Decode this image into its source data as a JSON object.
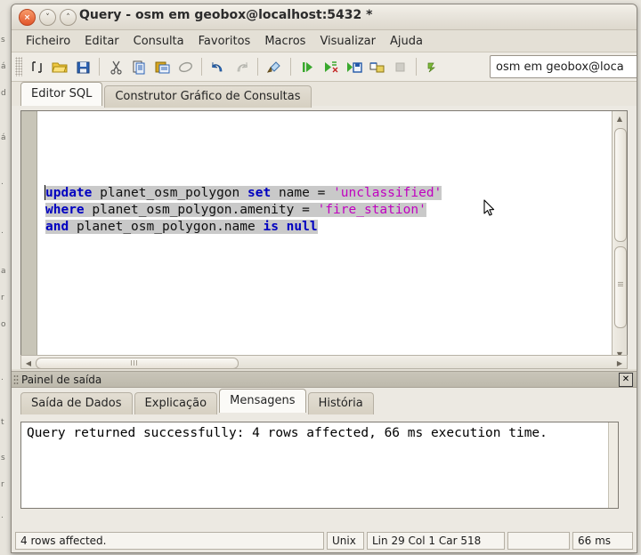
{
  "window": {
    "title": "Query - osm em geobox@localhost:5432 *",
    "buttons": {
      "close": "×",
      "minimize": "˅",
      "maximize": "˄"
    }
  },
  "menubar": {
    "items": [
      {
        "label": "Ficheiro"
      },
      {
        "label": "Editar"
      },
      {
        "label": "Consulta"
      },
      {
        "label": "Favoritos"
      },
      {
        "label": "Macros"
      },
      {
        "label": "Visualizar"
      },
      {
        "label": "Ajuda"
      }
    ]
  },
  "toolbar": {
    "icons": [
      "new-query-icon",
      "open-file-icon",
      "save-file-icon",
      "cut-icon",
      "copy-icon",
      "paste-icon",
      "clear-icon",
      "undo-icon",
      "redo-icon",
      "find-icon",
      "execute-query-icon",
      "explain-query-icon",
      "execute-to-file-icon",
      "query-builder-icon",
      "stop-icon",
      "macro-icon"
    ],
    "database_combo": {
      "value": "osm em geobox@loca",
      "name": "database-selector"
    }
  },
  "tabs": {
    "items": [
      {
        "label": "Editor SQL",
        "active": true
      },
      {
        "label": "Construtor Gráfico de Consultas",
        "active": false
      }
    ]
  },
  "editor": {
    "sql_lines": [
      [
        {
          "t": "update",
          "c": "kw"
        },
        {
          "t": " ",
          "c": "op"
        },
        {
          "t": "planet_osm_polygon",
          "c": "id"
        },
        {
          "t": " ",
          "c": "op"
        },
        {
          "t": "set",
          "c": "kw"
        },
        {
          "t": " ",
          "c": "op"
        },
        {
          "t": "name",
          "c": "id"
        },
        {
          "t": " = ",
          "c": "op"
        },
        {
          "t": "'unclassified'",
          "c": "str"
        }
      ],
      [
        {
          "t": "where",
          "c": "kw"
        },
        {
          "t": " ",
          "c": "op"
        },
        {
          "t": "planet_osm_polygon.amenity",
          "c": "id"
        },
        {
          "t": " = ",
          "c": "op"
        },
        {
          "t": "'fire_station'",
          "c": "str"
        }
      ],
      [
        {
          "t": "and",
          "c": "kw"
        },
        {
          "t": " ",
          "c": "op"
        },
        {
          "t": "planet_osm_polygon.name",
          "c": "id"
        },
        {
          "t": " ",
          "c": "op"
        },
        {
          "t": "is",
          "c": "kw"
        },
        {
          "t": " ",
          "c": "op"
        },
        {
          "t": "null",
          "c": "kw"
        }
      ]
    ],
    "plain_sql": "update planet_osm_polygon set name = 'unclassified'\nwhere planet_osm_polygon.amenity = 'fire_station'\nand planet_osm_polygon.name is null",
    "selection_color": "#c9c9c9",
    "keyword_color": "#0000c0",
    "string_color": "#c000c0"
  },
  "output_panel": {
    "title": "Painel de saída",
    "close_label": "✕",
    "tabs": [
      {
        "label": "Saída de Dados",
        "active": false
      },
      {
        "label": "Explicação",
        "active": false
      },
      {
        "label": "Mensagens",
        "active": true
      },
      {
        "label": "História",
        "active": false
      }
    ],
    "message": "Query returned successfully: 4 rows affected, 66 ms execution time."
  },
  "statusbar": {
    "message": "4 rows affected.",
    "eol": "Unix",
    "position": "Lin 29 Col 1 Car 518",
    "blank": "",
    "time": "66 ms"
  },
  "background_window": {
    "fragments": [
      "s",
      "á",
      "d",
      "á",
      ".",
      ".",
      "a",
      "r",
      "o",
      ".",
      "t",
      "s",
      "r",
      "."
    ]
  }
}
